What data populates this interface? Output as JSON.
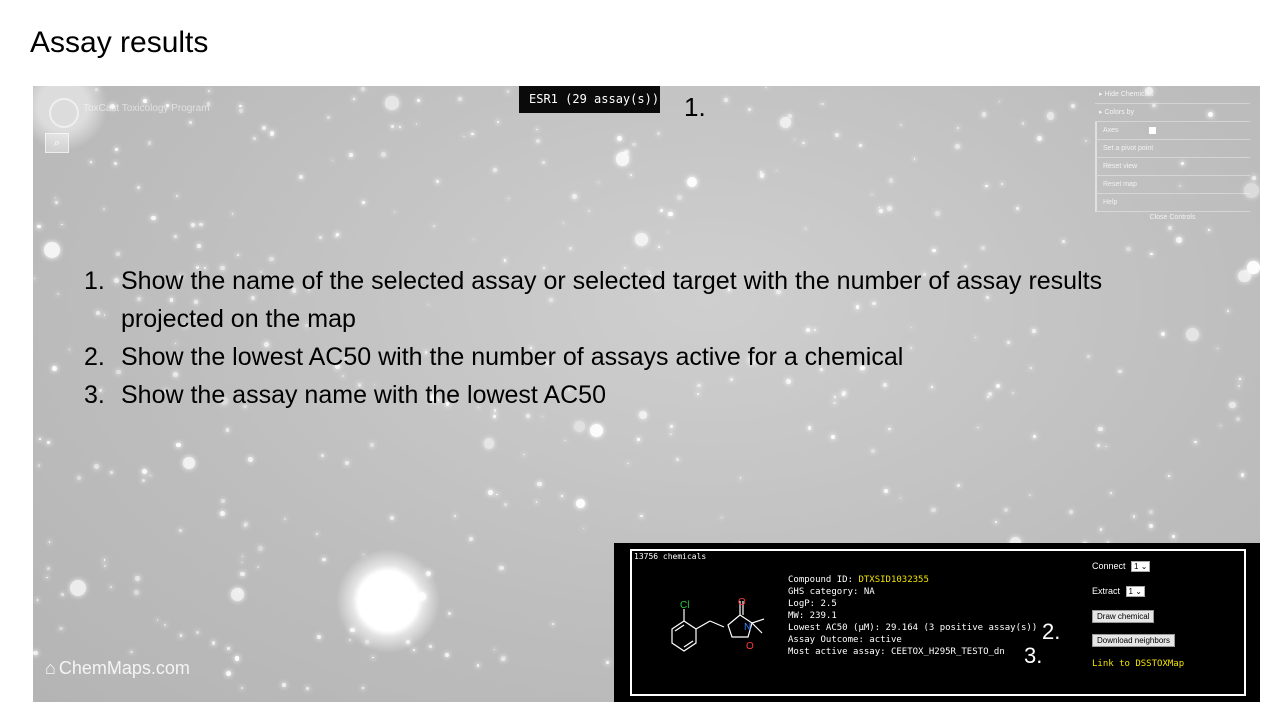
{
  "slide": {
    "title": "Assay results"
  },
  "map": {
    "logo_text": "ToxCast Toxicology Program",
    "search_icon": "search-icon",
    "assay_badge": "ESR1 (29 assay(s))",
    "watermark": "ChemMaps.com",
    "home_icon": "home-icon"
  },
  "controls": {
    "items": [
      "Hide Chemicals",
      "Colors by",
      "Axes",
      "Set a pivot point",
      "Reset view",
      "Reset map",
      "Help"
    ],
    "close_label": "Close Controls"
  },
  "markers": {
    "one": "1.",
    "two": "2.",
    "three": "3."
  },
  "bullets": [
    {
      "num": "1.",
      "text": "Show the name of the selected assay or selected target with the number of assay results projected on the map"
    },
    {
      "num": "2.",
      "text": "Show the lowest AC50 with the number of assays active for a chemical"
    },
    {
      "num": "3.",
      "text": "Show the assay name with the lowest AC50"
    }
  ],
  "panel": {
    "chemical_count": "13756 chemicals",
    "compound_id_label": "Compound ID: ",
    "compound_id": "DTXSID1032355",
    "ghs": "GHS category: NA",
    "logp": "LogP: 2.5",
    "mw": "MW: 239.1",
    "lowest_ac50": "Lowest AC50 (μM): 29.164 (3 positive assay(s))",
    "outcome": "Assay Outcome: active",
    "most_active": "Most active assay: CEETOX_H295R_TESTO_dn",
    "connect_label": "Connect",
    "connect_value": "1 ⌄",
    "extract_label": "Extract",
    "extract_value": "1 ⌄",
    "draw_button": "Draw chemical",
    "download_button": "Download neighbors",
    "link": "Link to DSSTOXMap",
    "atom_cl": "Cl",
    "atom_n": "N",
    "atom_o1": "O",
    "atom_o2": "O"
  }
}
